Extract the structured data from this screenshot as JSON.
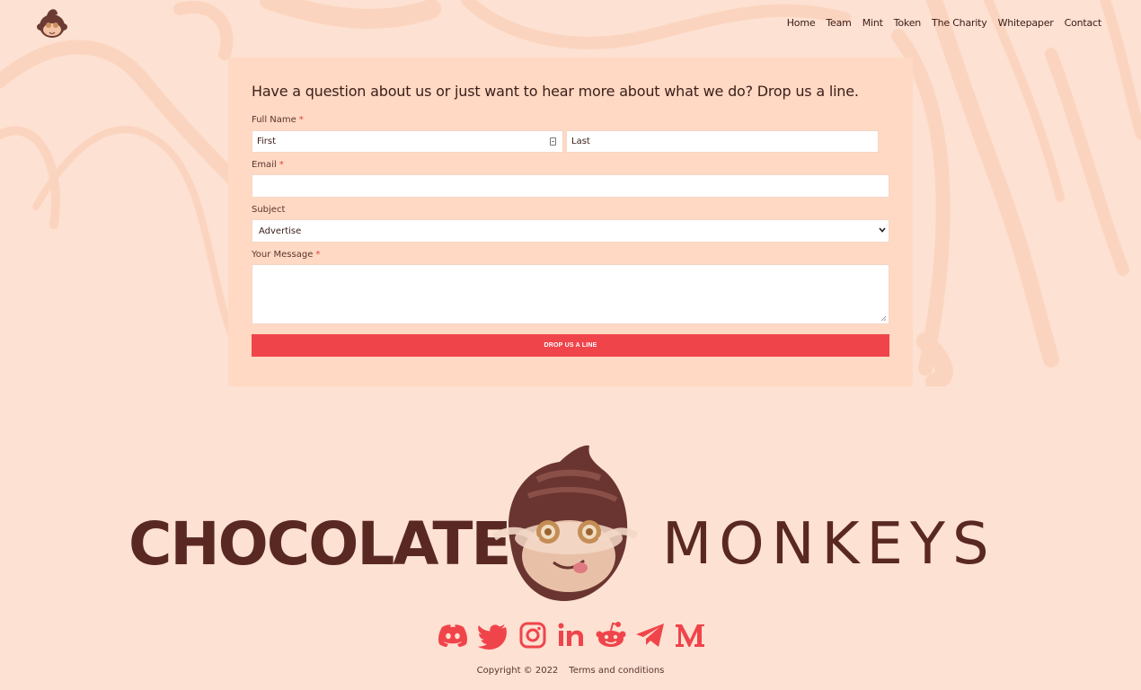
{
  "colors": {
    "background": "#fde1d2",
    "card": "#ffd9c3",
    "accent": "#f0444b",
    "brand_brown": "#5a2823"
  },
  "header": {
    "logo_icon": "chocolate-monkey-logo-icon",
    "nav": [
      "Home",
      "Team",
      "Mint",
      "Token",
      "The Charity",
      "Whitepaper",
      "Contact"
    ]
  },
  "form": {
    "heading": "Have a question about us or just want to hear more about what we do? Drop us a line.",
    "full_name_label": "Full Name",
    "required_mark": "*",
    "first_placeholder": "First",
    "last_placeholder": "Last",
    "email_label": "Email",
    "subject_label": "Subject",
    "subject_value": "Advertise",
    "message_label": "Your Message",
    "submit_label": "DROP US A LINE"
  },
  "footer": {
    "brand_left": "CHOCOLATE",
    "brand_right": "MONKEYS",
    "social_icons": [
      "discord-icon",
      "twitter-icon",
      "instagram-icon",
      "linkedin-icon",
      "reddit-icon",
      "telegram-icon",
      "medium-icon"
    ],
    "copyright": "Copyright © 2022",
    "terms_link": "Terms and conditions"
  }
}
